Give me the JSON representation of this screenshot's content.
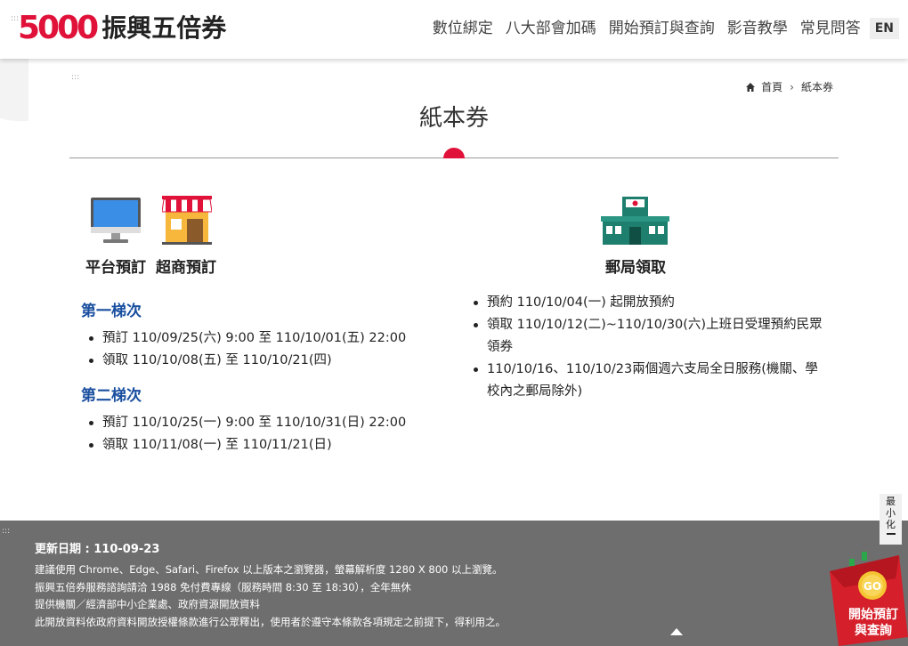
{
  "header": {
    "logo_number": "5000",
    "logo_text": "振興五倍券",
    "nav": [
      "數位綁定",
      "八大部會加碼",
      "開始預訂與查詢",
      "影音教學",
      "常見問答"
    ],
    "lang": "EN",
    "skip_marker": ":::"
  },
  "breadcrumb": {
    "home": "首頁",
    "separator": "›",
    "current": "紙本券"
  },
  "page_title": "紙本券",
  "left": {
    "icons": [
      "computer-icon",
      "convenience-store-icon"
    ],
    "heading_platform": "平台預訂",
    "heading_store": "超商預訂",
    "batch1": {
      "title": "第一梯次",
      "items": [
        "預訂 110/09/25(六) 9:00 至 110/10/01(五) 22:00",
        "領取 110/10/08(五) 至 110/10/21(四)"
      ]
    },
    "batch2": {
      "title": "第二梯次",
      "items": [
        "預訂 110/10/25(一) 9:00 至 110/10/31(日) 22:00",
        "領取 110/11/08(一) 至 110/11/21(日)"
      ]
    }
  },
  "right": {
    "icon": "post-office-icon",
    "heading": "郵局領取",
    "items": [
      "預約 110/10/04(一) 起開放預約",
      "領取 110/10/12(二)~110/10/30(六)上班日受理預約民眾領券",
      "110/10/16、110/10/23兩個週六支局全日服務(機關、學校內之郵局除外)"
    ]
  },
  "footer": {
    "skip_marker": ":::",
    "update": "更新日期 : 110-09-23",
    "lines": [
      "建議使用 Chrome、Edge、Safari、Firefox 以上版本之瀏覽器，螢幕解析度 1280 X 800 以上瀏覽。",
      "振興五倍券服務諮詢請洽 1988 免付費專線（服務時間 8:30 至 18:30），全年無休",
      "提供機關／經濟部中小企業處、政府資源開放資料",
      "此開放資料依政府資料開放授權條款進行公眾釋出，使用者於遵守本條款各項規定之前提下，得利用之。"
    ]
  },
  "minimize": {
    "label": "最小化"
  },
  "promo": {
    "badge": "GO",
    "label": "開始預訂與查詢"
  },
  "colors": {
    "brand_red": "#e0123a",
    "batch_blue": "#1a4fa0",
    "footer_gray": "#6e6e6e"
  }
}
